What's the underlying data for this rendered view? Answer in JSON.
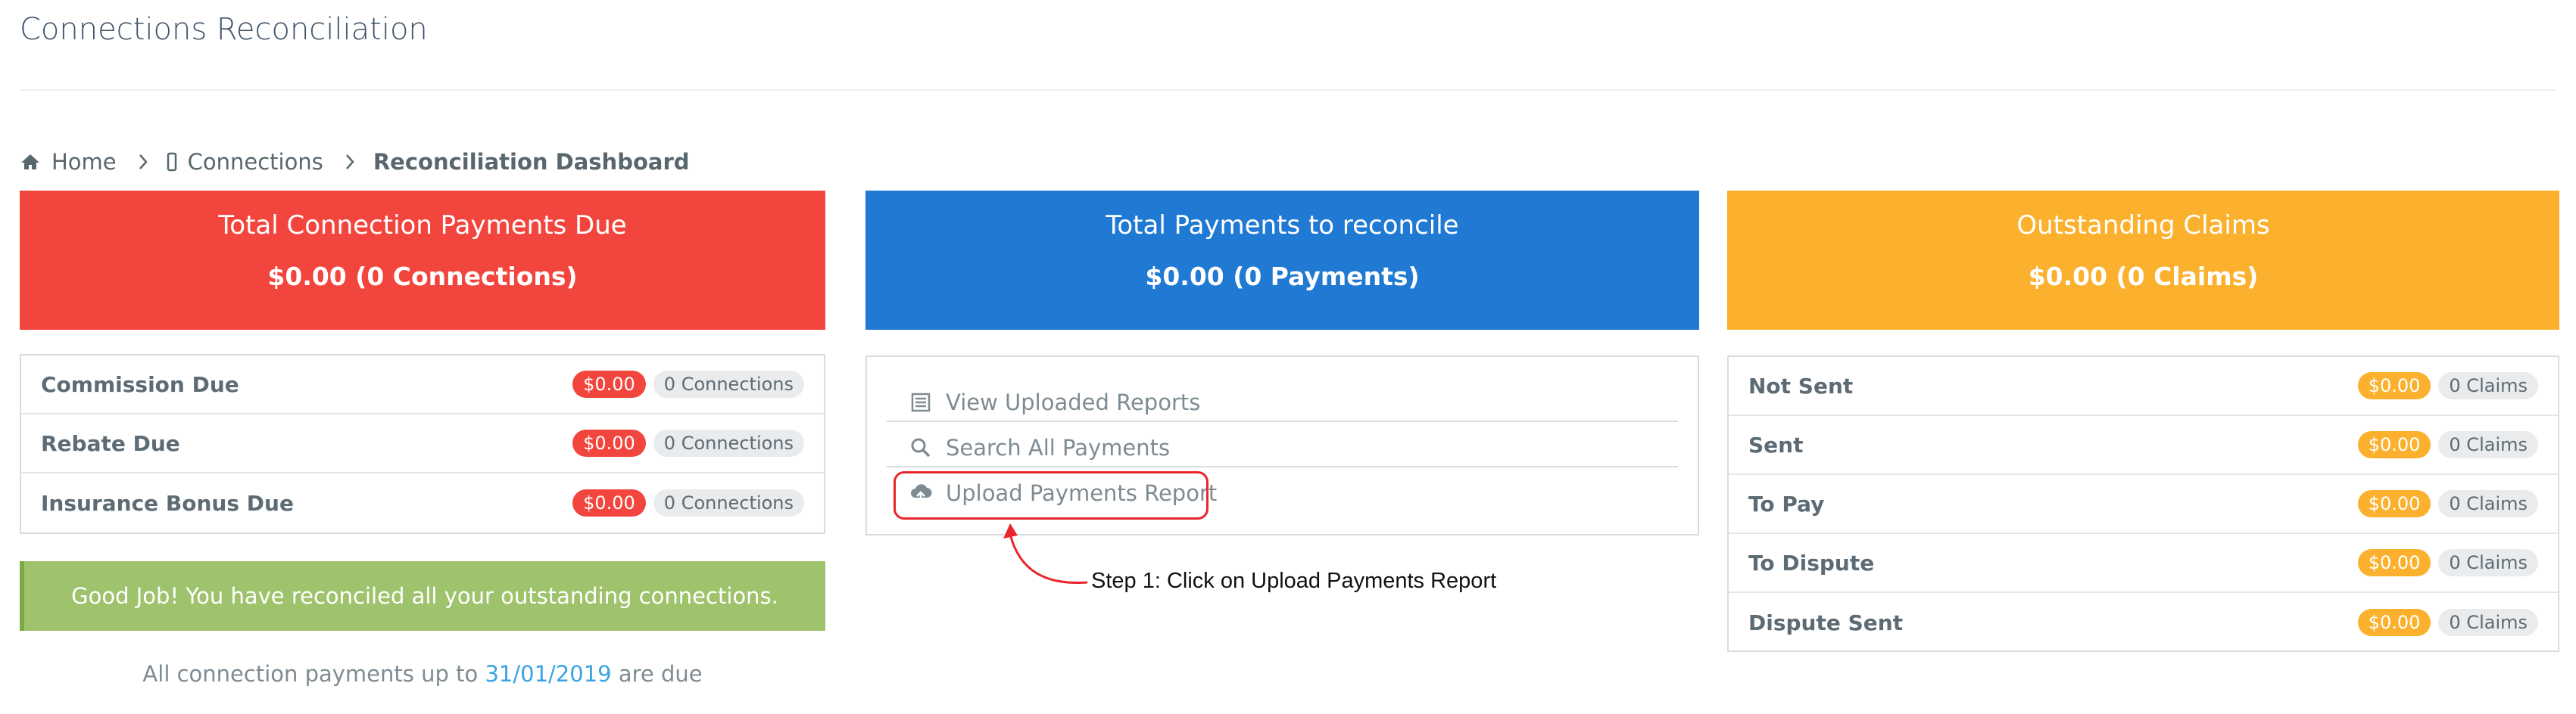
{
  "page": {
    "title": "Connections Reconciliation"
  },
  "breadcrumb": {
    "home": "Home",
    "connections": "Connections",
    "current": "Reconciliation Dashboard"
  },
  "cards": {
    "due": {
      "title": "Total Connection Payments Due",
      "value": "$0.00 (0 Connections)",
      "color": "#f2453d"
    },
    "payments": {
      "title": "Total Payments to reconcile",
      "value": "$0.00 (0 Payments)",
      "color": "#2079d3"
    },
    "claims": {
      "title": "Outstanding Claims",
      "value": "$0.00 (0 Claims)",
      "color": "#fbb12d"
    }
  },
  "due_list": [
    {
      "label": "Commission Due",
      "amount": "$0.00",
      "count": "0 Connections"
    },
    {
      "label": "Rebate Due",
      "amount": "$0.00",
      "count": "0 Connections"
    },
    {
      "label": "Insurance Bonus Due",
      "amount": "$0.00",
      "count": "0 Connections"
    }
  ],
  "payments_menu": [
    {
      "label": "View Uploaded Reports",
      "icon": "list-icon"
    },
    {
      "label": "Search All Payments",
      "icon": "search-icon"
    },
    {
      "label": "Upload Payments Report",
      "icon": "cloud-upload-icon"
    }
  ],
  "claims_list": [
    {
      "label": "Not Sent",
      "amount": "$0.00",
      "count": "0 Claims"
    },
    {
      "label": "Sent",
      "amount": "$0.00",
      "count": "0 Claims"
    },
    {
      "label": "To Pay",
      "amount": "$0.00",
      "count": "0 Claims"
    },
    {
      "label": "To Dispute",
      "amount": "$0.00",
      "count": "0 Claims"
    },
    {
      "label": "Dispute Sent",
      "amount": "$0.00",
      "count": "0 Claims"
    }
  ],
  "success_message": "Good Job! You have reconciled all your outstanding connections.",
  "footer": {
    "prefix": "All connection payments up to",
    "date": "31/01/2019",
    "suffix": "are due"
  },
  "annotation": {
    "text": "Step 1: Click on Upload Payments Report",
    "color": "#e8262b"
  }
}
